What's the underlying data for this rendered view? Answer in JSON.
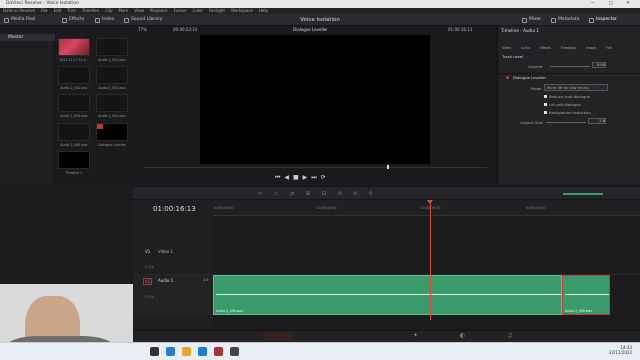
{
  "titlebar": {
    "title": "DaVinci Resolve - Voice Isolation",
    "controls": "— ▢ ✕"
  },
  "menubar": [
    "DaVinci Resolve",
    "File",
    "Edit",
    "Trim",
    "Timeline",
    "Clip",
    "Mark",
    "View",
    "Playback",
    "Fusion",
    "Color",
    "Fairlight",
    "Workspace",
    "Help"
  ],
  "toolbar": {
    "media_pool": "Media Pool",
    "effects": "Effects",
    "index": "Index",
    "sound_library": "Sound Library",
    "project_title": "Voice Isolation",
    "mixer": "Mixer",
    "metadata": "Metadata",
    "inspector": "Inspector"
  },
  "viewer": {
    "zoom": "77%",
    "timecode_left": "00:00:23:10",
    "clip_name": "Dialogue Leveller",
    "timecode_right": "01:00:16:13"
  },
  "leftpanel": {
    "master": "Master"
  },
  "media_pool": {
    "clips": [
      {
        "name": "2022-11-27 12-5..."
      },
      {
        "name": "Audio 2_001.wav"
      },
      {
        "name": "Audio 2_002.wav"
      },
      {
        "name": "Audio 2_003.wav"
      },
      {
        "name": "Audio 2_004.wav"
      },
      {
        "name": "Audio 2_005.wav"
      },
      {
        "name": "Audio 2_006.wav"
      },
      {
        "name": "Dialogue Leveller"
      },
      {
        "name": "Timeline 1"
      }
    ]
  },
  "inspector": {
    "title": "Timeline - Audio 1",
    "tabs": [
      "Video",
      "Audio",
      "Effects",
      "Transition",
      "Image",
      "File"
    ],
    "track_level": "Track Level",
    "volume_label": "Volume",
    "volume_value": "0.00",
    "effect_name": "Dialogue Leveller",
    "mode_label": "Mode",
    "mode_value": "More lift for low levels",
    "opt1": "Reduce loud dialogue",
    "opt2": "Lift soft dialogue",
    "opt3": "Background reduction",
    "output_gain_label": "Output Gain",
    "output_gain_value": "2.6"
  },
  "timeline": {
    "timecode": "01:00:16:13",
    "ruler": [
      "01:00:00:00",
      "01:00:08:00",
      "01:00:16:00",
      "01:00:24:00"
    ],
    "v1_label": "V1",
    "v1_name": "Video 1",
    "a1_label": "A1",
    "a1_name": "Audio 1",
    "a1_level": "2.0",
    "clip_a": "Audio 2_006.wav",
    "clip_b": "Audio 2_006.wav",
    "clip_count": "0 Clip"
  },
  "taskbar": {
    "time": "14:43",
    "date": "22/11/2022"
  }
}
